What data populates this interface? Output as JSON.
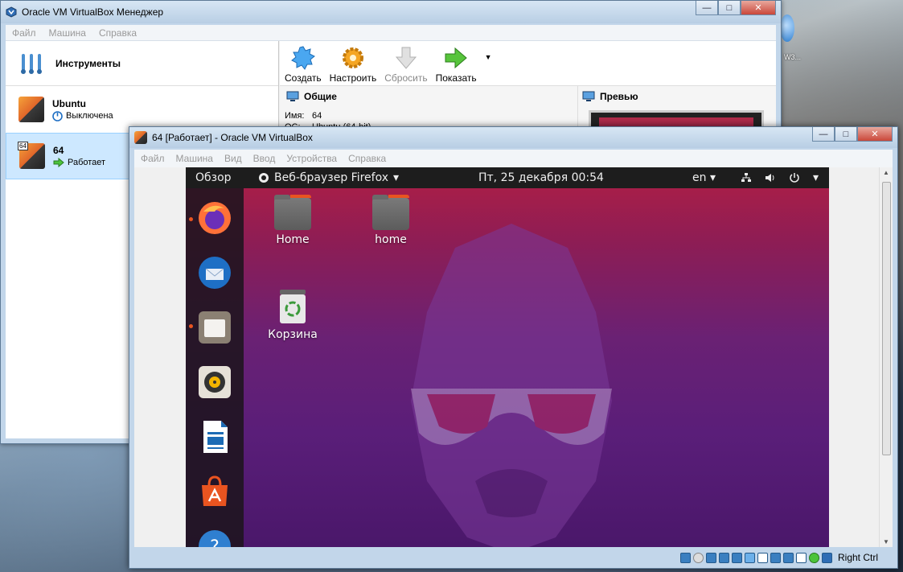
{
  "manager": {
    "title": "Oracle VM VirtualBox Менеджер",
    "menu": [
      "Файл",
      "Машина",
      "Справка"
    ],
    "tools_label": "Инструменты",
    "vms": [
      {
        "name": "Ubuntu",
        "state": "Выключена"
      },
      {
        "badge": "64",
        "name": "64",
        "state": "Работает"
      }
    ],
    "toolbar": {
      "create": "Создать",
      "settings": "Настроить",
      "discard": "Сбросить",
      "show": "Показать"
    },
    "general_header": "Общие",
    "preview_header": "Превью",
    "details": {
      "name_key": "Имя:",
      "name_val": "64",
      "os_key": "ОС:",
      "os_val": "Ubuntu (64-bit)"
    }
  },
  "vm_window": {
    "title": "64 [Работает] - Oracle VM VirtualBox",
    "menu": [
      "Файл",
      "Машина",
      "Вид",
      "Ввод",
      "Устройства",
      "Справка"
    ],
    "host_key": "Right Ctrl"
  },
  "ubuntu": {
    "activities": "Обзор",
    "app_menu": "Веб-браузер Firefox",
    "clock": "Пт, 25 декабря  00:54",
    "lang": "en",
    "desktop_icons": [
      "Home",
      "home",
      "Корзина"
    ]
  },
  "desktop": {
    "label": "W3..."
  },
  "colors": {
    "ubuntu_orange": "#e95420",
    "selection": "#cde8ff"
  }
}
